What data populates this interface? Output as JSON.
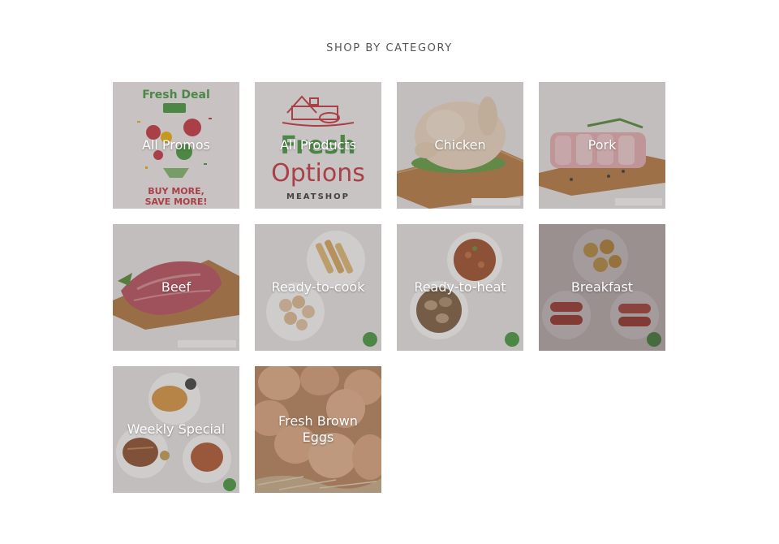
{
  "section": {
    "title": "SHOP BY CATEGORY"
  },
  "categories": [
    {
      "label": "All Promos",
      "art": "promo-art",
      "image_text": [
        "Fresh Deal",
        "BUY MORE,",
        "SAVE MORE!"
      ]
    },
    {
      "label": "All Products",
      "art": "logo-art",
      "image_text": [
        "Fresh",
        "Options",
        "MEATSHOP"
      ]
    },
    {
      "label": "Chicken",
      "art": "chicken-art"
    },
    {
      "label": "Pork",
      "art": "pork-art"
    },
    {
      "label": "Beef",
      "art": "beef-art"
    },
    {
      "label": "Ready-to-cook",
      "art": "ready-to-cook-art"
    },
    {
      "label": "Ready-to-heat",
      "art": "ready-to-heat-art"
    },
    {
      "label": "Breakfast",
      "art": "breakfast-art"
    },
    {
      "label": "Weekly Special",
      "art": "weekly-special-art"
    },
    {
      "label": "Fresh Brown Eggs",
      "art": "eggs-art"
    }
  ],
  "colors": {
    "heading": "#555555",
    "label": "#ffffff",
    "brand_red": "#c8323c",
    "brand_green": "#3f9a3a"
  }
}
